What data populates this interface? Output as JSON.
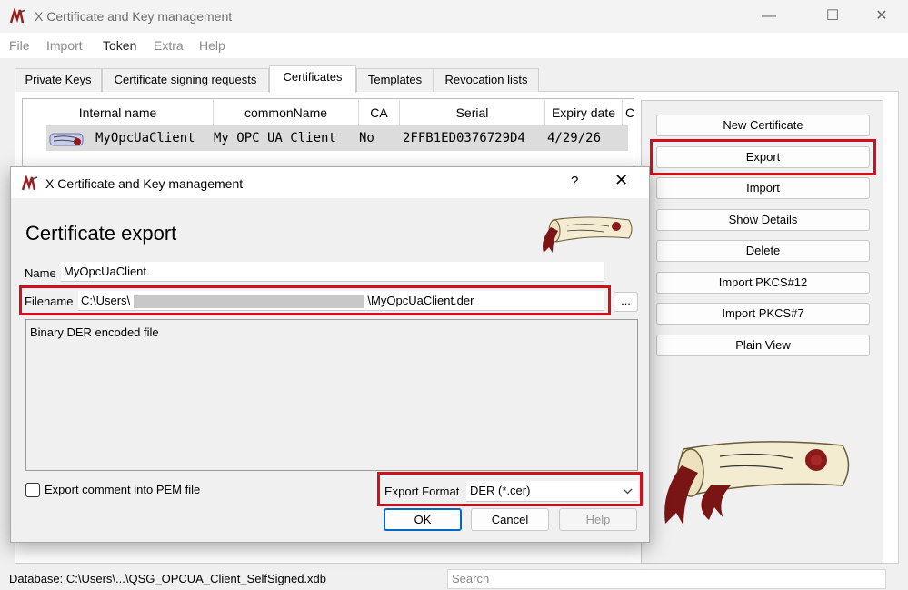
{
  "window": {
    "title": "X Certificate and Key management",
    "minimize": "—",
    "maximize": "☐",
    "close": "✕"
  },
  "menu": [
    "File",
    "Import",
    "Token",
    "Extra",
    "Help"
  ],
  "tabs": [
    "Private Keys",
    "Certificate signing requests",
    "Certificates",
    "Templates",
    "Revocation lists"
  ],
  "active_tab": "Certificates",
  "table": {
    "columns": [
      "Internal name",
      "commonName",
      "CA",
      "Serial",
      "Expiry date",
      "C"
    ],
    "rows": [
      {
        "internal_name": "MyOpcUaClient",
        "common_name": "My OPC UA Client",
        "ca": "No",
        "serial": "2FFB1ED0376729D4",
        "expiry": "4/29/26"
      }
    ]
  },
  "side_buttons": [
    "New Certificate",
    "Export",
    "Import",
    "Show Details",
    "Delete",
    "Import PKCS#12",
    "Import PKCS#7",
    "Plain View"
  ],
  "status": {
    "database": "Database: C:\\Users\\...\\QSG_OPCUA_Client_SelfSigned.xdb",
    "search_placeholder": "Search"
  },
  "dialog": {
    "title": "X Certificate and Key management",
    "help": "?",
    "close": "✕",
    "heading": "Certificate export",
    "name_label": "Name",
    "name_value": "MyOpcUaClient",
    "filename_label": "Filename",
    "filename_prefix": "C:\\Users\\",
    "filename_suffix": "\\MyOpcUaClient.der",
    "browse_label": "...",
    "description": "Binary DER encoded file",
    "export_comment_label": "Export comment into PEM file",
    "export_format_label": "Export Format",
    "export_format_value": "DER (*.cer)",
    "ok_label": "OK",
    "cancel_label": "Cancel",
    "help_label": "Help"
  },
  "colors": {
    "highlight": "#d0101a",
    "accent": "#0067c0",
    "seal": "#8b1a1a"
  }
}
